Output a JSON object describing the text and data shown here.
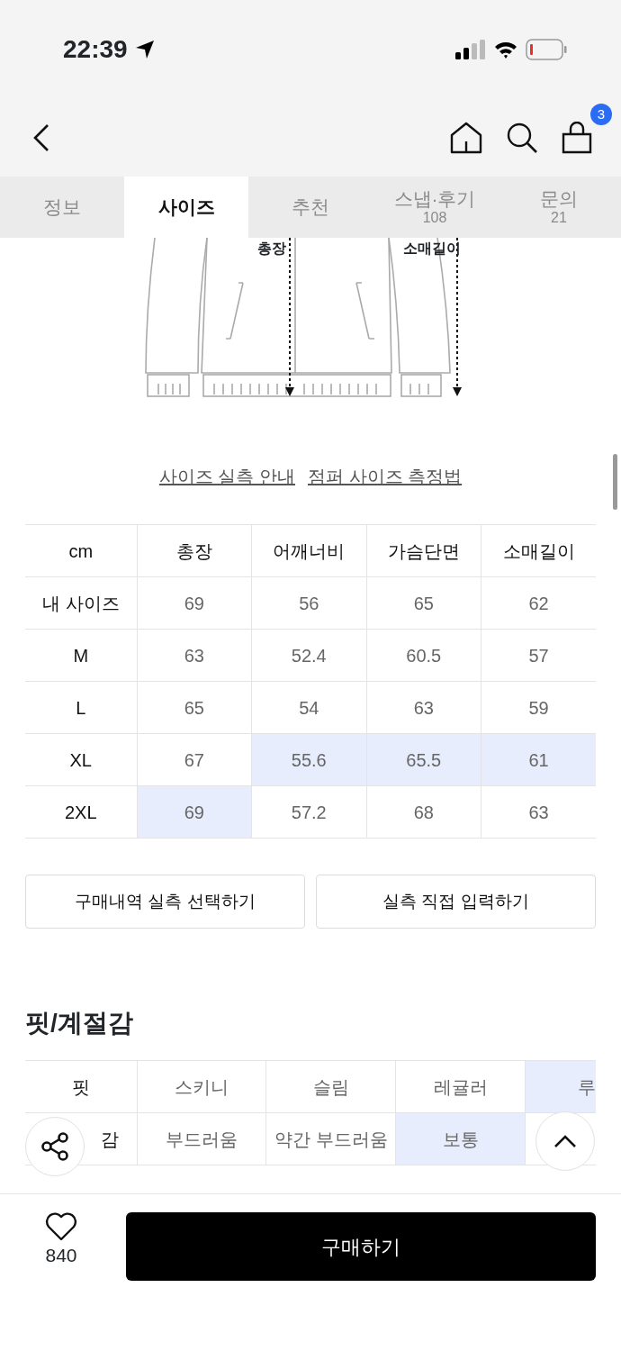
{
  "status_bar": {
    "time": "22:39"
  },
  "nav": {
    "cart_count": "3"
  },
  "tabs": [
    {
      "label": "정보",
      "selected": false
    },
    {
      "label": "사이즈",
      "selected": true
    },
    {
      "label": "추천",
      "selected": false
    },
    {
      "label": "스냅·후기",
      "count": "108",
      "selected": false
    },
    {
      "label": "문의",
      "count": "21",
      "selected": false
    }
  ],
  "size_guide": {
    "diagram_labels": [
      "총장",
      "소매길이"
    ],
    "links": [
      "사이즈 실측 안내",
      "점퍼 사이즈 측정법"
    ],
    "table": {
      "corner": "cm",
      "columns": [
        "총장",
        "어깨너비",
        "가슴단면",
        "소매길이"
      ],
      "rows": [
        {
          "label": "내 사이즈",
          "cells": [
            {
              "text": "69",
              "highlighted": false
            },
            {
              "text": "56",
              "highlighted": false
            },
            {
              "text": "65",
              "highlighted": false
            },
            {
              "text": "62",
              "highlighted": false
            }
          ]
        },
        {
          "label": "M",
          "cells": [
            {
              "text": "63",
              "highlighted": false
            },
            {
              "text": "52.4",
              "highlighted": false
            },
            {
              "text": "60.5",
              "highlighted": false
            },
            {
              "text": "57",
              "highlighted": false
            }
          ]
        },
        {
          "label": "L",
          "cells": [
            {
              "text": "65",
              "highlighted": false
            },
            {
              "text": "54",
              "highlighted": false
            },
            {
              "text": "63",
              "highlighted": false
            },
            {
              "text": "59",
              "highlighted": false
            }
          ]
        },
        {
          "label": "XL",
          "cells": [
            {
              "text": "67",
              "highlighted": false
            },
            {
              "text": "55.6",
              "highlighted": true
            },
            {
              "text": "65.5",
              "highlighted": true
            },
            {
              "text": "61",
              "highlighted": true
            }
          ]
        },
        {
          "label": "2XL",
          "cells": [
            {
              "text": "69",
              "highlighted": true
            },
            {
              "text": "57.2",
              "highlighted": false
            },
            {
              "text": "68",
              "highlighted": false
            },
            {
              "text": "63",
              "highlighted": false
            }
          ]
        }
      ]
    },
    "buttons": [
      "구매내역 실측 선택하기",
      "실측 직접 입력하기"
    ]
  },
  "fit": {
    "title": "핏/계절감",
    "rows": [
      {
        "label": "핏",
        "cells": [
          {
            "text": "스키니",
            "selected": false
          },
          {
            "text": "슬림",
            "selected": false
          },
          {
            "text": "레귤러",
            "selected": false
          },
          {
            "text": "루",
            "selected": true
          }
        ]
      },
      {
        "label": "감",
        "cells": [
          {
            "text": "부드러움",
            "selected": false
          },
          {
            "text": "약간 부드러움",
            "selected": false
          },
          {
            "text": "보통",
            "selected": true
          },
          {
            "selected": false
          }
        ]
      }
    ]
  },
  "bottom_bar": {
    "like_count": "840",
    "buy_button": "구매하기"
  }
}
